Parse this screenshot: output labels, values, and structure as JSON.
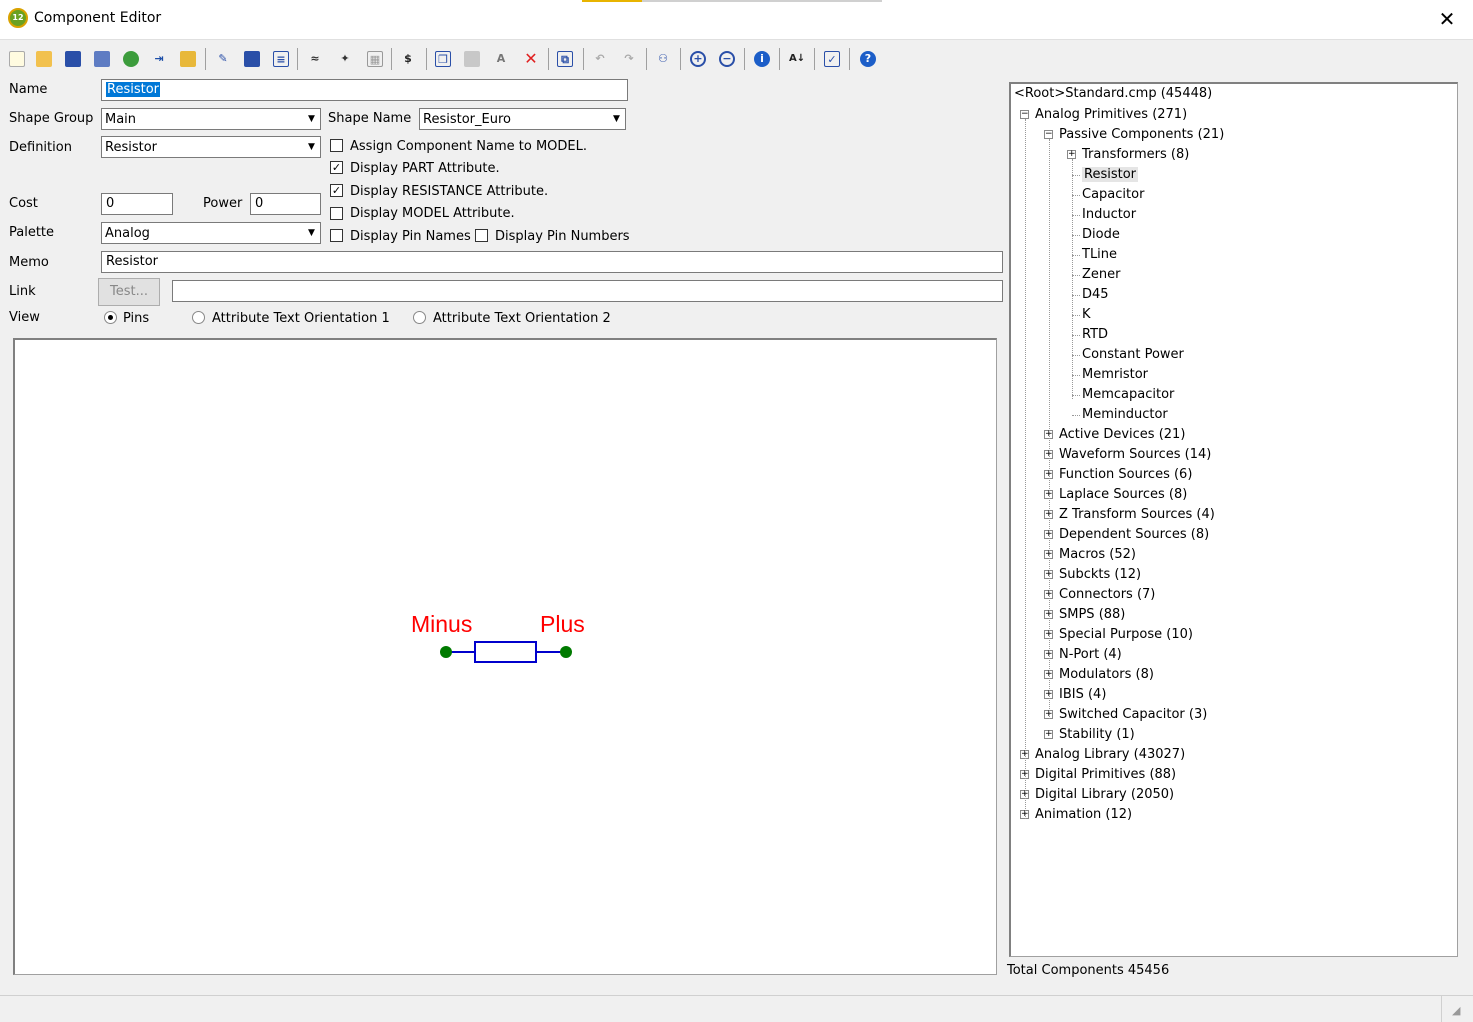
{
  "window": {
    "title": "Component Editor",
    "app_icon": "12",
    "close_icon": "✕"
  },
  "toolbar": {
    "icons": [
      "new-icon",
      "open-icon",
      "save-icon",
      "save-as-icon",
      "refresh-icon",
      "export-icon",
      "folder-icon",
      "brush-icon",
      "save-disk-icon",
      "list-icon",
      "wave-icon",
      "cursor-add-icon",
      "grid-icon",
      "dollar-icon",
      "copy-icon",
      "paste-icon",
      "find-replace-icon",
      "delete-icon",
      "merge-icon",
      "undo-icon",
      "redo-icon",
      "binoculars-icon",
      "zoom-in-icon",
      "zoom-out-icon",
      "info-icon",
      "sort-icon",
      "properties-icon",
      "help-icon"
    ]
  },
  "form": {
    "name_label": "Name",
    "name_value": "Resistor",
    "shape_group_label": "Shape Group",
    "shape_group_value": "Main",
    "shape_name_label": "Shape Name",
    "shape_name_value": "Resistor_Euro",
    "definition_label": "Definition",
    "definition_value": "Resistor",
    "cost_label": "Cost",
    "cost_value": "0",
    "power_label": "Power",
    "power_value": "0",
    "palette_label": "Palette",
    "palette_value": "Analog",
    "memo_label": "Memo",
    "memo_value": "Resistor",
    "link_label": "Link",
    "test_button": "Test...",
    "link_value": "",
    "view_label": "View",
    "checkboxes": [
      {
        "label": "Assign Component Name to MODEL.",
        "checked": false
      },
      {
        "label": "Display PART Attribute.",
        "checked": true
      },
      {
        "label": "Display RESISTANCE Attribute.",
        "checked": true
      },
      {
        "label": "Display MODEL Attribute.",
        "checked": false
      },
      {
        "label": "Display Pin Names",
        "checked": false
      },
      {
        "label": "Display Pin Numbers",
        "checked": false
      }
    ],
    "radios": [
      {
        "label": "Pins",
        "selected": true
      },
      {
        "label": "Attribute Text Orientation 1",
        "selected": false
      },
      {
        "label": "Attribute Text Orientation 2",
        "selected": false
      }
    ]
  },
  "canvas": {
    "pin_minus": "Minus",
    "pin_plus": "Plus",
    "pin_color": "#ff0000",
    "body_color": "#0000cc",
    "dot_color": "#007a00"
  },
  "tree": {
    "root": "<Root>Standard.cmp (45448)",
    "items": [
      {
        "label": "Analog Primitives (271)",
        "level": 1,
        "expander": "−"
      },
      {
        "label": "Passive Components (21)",
        "level": 2,
        "expander": "−"
      },
      {
        "label": "Transformers (8)",
        "level": 3,
        "expander": "+"
      },
      {
        "label": "Resistor",
        "level": 3,
        "expander": "",
        "selected": true
      },
      {
        "label": "Capacitor",
        "level": 3,
        "expander": ""
      },
      {
        "label": "Inductor",
        "level": 3,
        "expander": ""
      },
      {
        "label": "Diode",
        "level": 3,
        "expander": ""
      },
      {
        "label": "TLine",
        "level": 3,
        "expander": ""
      },
      {
        "label": "Zener",
        "level": 3,
        "expander": ""
      },
      {
        "label": "D45",
        "level": 3,
        "expander": ""
      },
      {
        "label": "K",
        "level": 3,
        "expander": ""
      },
      {
        "label": "RTD",
        "level": 3,
        "expander": ""
      },
      {
        "label": "Constant Power",
        "level": 3,
        "expander": ""
      },
      {
        "label": "Memristor",
        "level": 3,
        "expander": ""
      },
      {
        "label": "Memcapacitor",
        "level": 3,
        "expander": ""
      },
      {
        "label": "Meminductor",
        "level": 3,
        "expander": ""
      },
      {
        "label": "Active Devices (21)",
        "level": 2,
        "expander": "+"
      },
      {
        "label": "Waveform Sources (14)",
        "level": 2,
        "expander": "+"
      },
      {
        "label": "Function Sources (6)",
        "level": 2,
        "expander": "+"
      },
      {
        "label": "Laplace Sources (8)",
        "level": 2,
        "expander": "+"
      },
      {
        "label": "Z Transform Sources (4)",
        "level": 2,
        "expander": "+"
      },
      {
        "label": "Dependent Sources (8)",
        "level": 2,
        "expander": "+"
      },
      {
        "label": "Macros (52)",
        "level": 2,
        "expander": "+"
      },
      {
        "label": "Subckts (12)",
        "level": 2,
        "expander": "+"
      },
      {
        "label": "Connectors (7)",
        "level": 2,
        "expander": "+"
      },
      {
        "label": "SMPS (88)",
        "level": 2,
        "expander": "+"
      },
      {
        "label": "Special Purpose (10)",
        "level": 2,
        "expander": "+"
      },
      {
        "label": "N-Port (4)",
        "level": 2,
        "expander": "+"
      },
      {
        "label": "Modulators (8)",
        "level": 2,
        "expander": "+"
      },
      {
        "label": "IBIS (4)",
        "level": 2,
        "expander": "+"
      },
      {
        "label": "Switched Capacitor (3)",
        "level": 2,
        "expander": "+"
      },
      {
        "label": "Stability (1)",
        "level": 2,
        "expander": "+"
      },
      {
        "label": "Analog Library (43027)",
        "level": 1,
        "expander": "+"
      },
      {
        "label": "Digital Primitives (88)",
        "level": 1,
        "expander": "+"
      },
      {
        "label": "Digital Library (2050)",
        "level": 1,
        "expander": "+"
      },
      {
        "label": "Animation (12)",
        "level": 1,
        "expander": "+"
      }
    ]
  },
  "footer": {
    "total_components": "Total Components 45456"
  }
}
